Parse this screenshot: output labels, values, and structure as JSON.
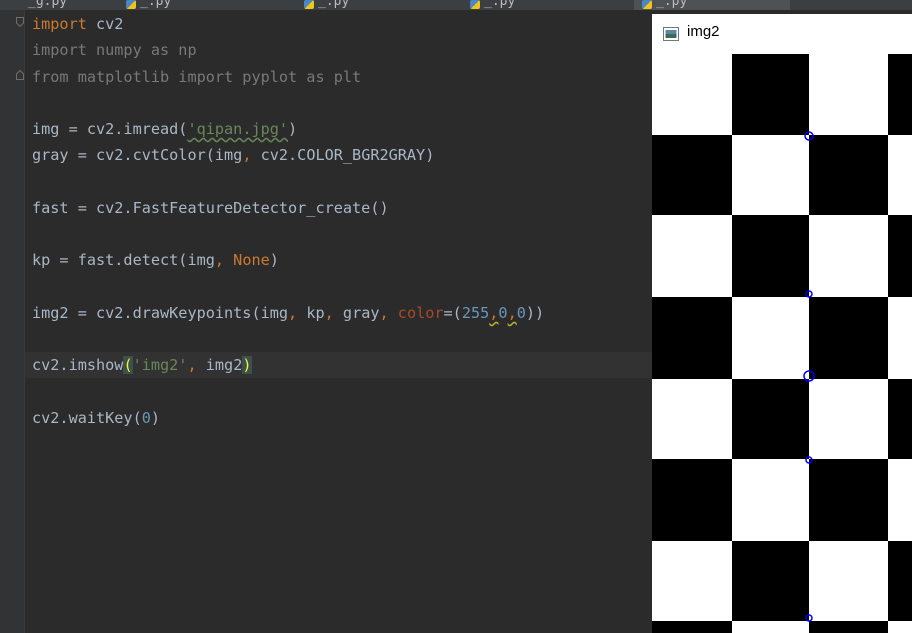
{
  "tabs": [
    {
      "label": "_g.py",
      "active": false
    },
    {
      "label": "_.py",
      "active": false
    },
    {
      "label": "_.py",
      "active": false
    },
    {
      "label": "_.py",
      "active": false
    },
    {
      "label": "_.py",
      "active": true
    }
  ],
  "code": {
    "line1": {
      "kw": "import",
      "rest": " cv2"
    },
    "line2": {
      "text": "import numpy as np"
    },
    "line3": {
      "text": "from matplotlib import pyplot as plt"
    },
    "line5": {
      "a": "img = cv2.imread(",
      "s": "'qipan.jpg'",
      "b": ")"
    },
    "line6": {
      "a": "gray = cv2.cvtColor(img",
      "comma": ",",
      "b": " cv2.COLOR_BGR2GRAY)"
    },
    "line8": {
      "a": "fast = cv2.FastFeatureDetector_create()"
    },
    "line10": {
      "a": "kp = fast.detect(img",
      "comma": ",",
      "none": " None",
      "b": ")"
    },
    "line12": {
      "a": "img2 = cv2.drawKeypoints(img",
      "c1": ",",
      "b": " kp",
      "c2": ",",
      "c": " gray",
      "c3": ",",
      "param": " color",
      "eq": "=(",
      "n1": "255",
      "c4": ",",
      "n2": "0",
      "c5": ",",
      "n3": "0",
      "d": "))"
    },
    "line14": {
      "a": "cv2.imshow",
      "paren": "(",
      "s": "'img2'",
      "comma": ",",
      "b": " img2",
      "close": ")"
    },
    "line16": {
      "a": "cv2.waitKey(",
      "n": "0",
      "b": ")"
    }
  },
  "window": {
    "title": "img2",
    "icon": "image-window-icon"
  },
  "colors": {
    "editor_bg": "#2b2b2b",
    "keyword": "#cc7832",
    "string": "#6a8759",
    "number": "#6897bb",
    "keypoint": "#0000ff"
  }
}
